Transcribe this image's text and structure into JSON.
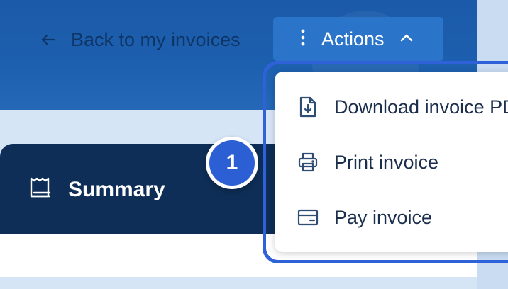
{
  "header": {
    "back_label": "Back to my invoices",
    "actions_label": "Actions"
  },
  "actions_menu": {
    "items": [
      {
        "label": "Download invoice PDF",
        "icon": "download-file-icon"
      },
      {
        "label": "Print invoice",
        "icon": "printer-icon"
      },
      {
        "label": "Pay invoice",
        "icon": "card-icon"
      }
    ]
  },
  "summary": {
    "title": "Summary",
    "icon": "receipt-icon"
  },
  "step_badge": "1",
  "colors": {
    "header": "#1c5fae",
    "actions_button": "#2a74c9",
    "summary_bg": "#0e2e57",
    "highlight": "#2f62d8",
    "back_text": "#0f3566"
  }
}
